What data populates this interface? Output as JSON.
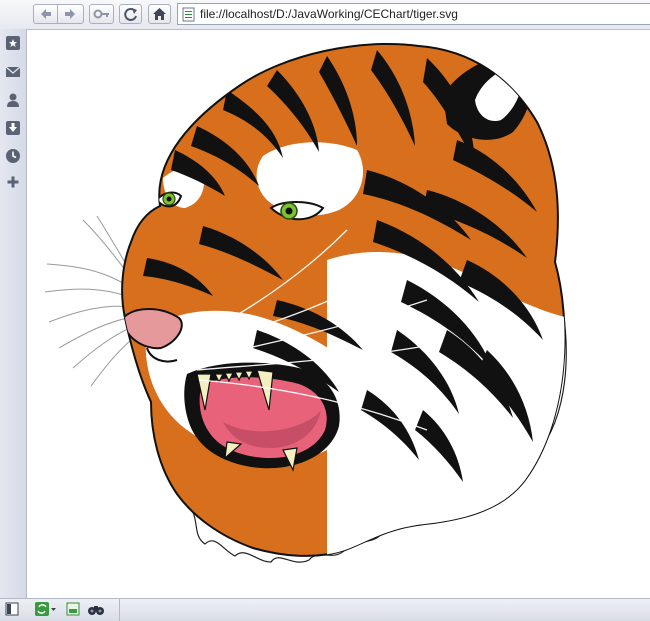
{
  "browser": {
    "toolbar": {
      "back_icon": "arrow-left-icon",
      "forward_icon": "arrow-right-icon",
      "key_icon": "key-icon",
      "reload_icon": "reload-icon",
      "home_icon": "home-icon"
    },
    "url": "file://localhost/D:/JavaWorking/CEChart/tiger.svg",
    "sidebar_icons": [
      "bookmark-icon",
      "mail-icon",
      "user-icon",
      "download-icon",
      "clock-icon",
      "plus-icon"
    ],
    "status_icons": [
      "panel-toggle-icon",
      "sync-icon",
      "image-icon",
      "binoculars-icon"
    ]
  },
  "document": {
    "image_subject": "tiger",
    "colors": {
      "orange": "#d86f1c",
      "black": "#111111",
      "eye": "#7cc232",
      "nose": "#e5999b",
      "mouth": "#e8637a",
      "fang": "#f3efc0"
    }
  }
}
